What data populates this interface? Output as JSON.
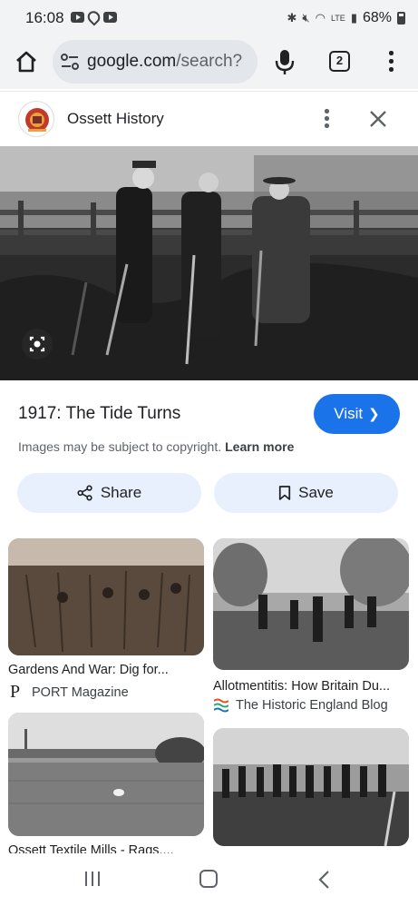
{
  "status_bar": {
    "time": "16:08",
    "battery": "68%",
    "network": "LTE"
  },
  "browser": {
    "url_host": "google.com",
    "url_path": "/search?",
    "tab_count": "2"
  },
  "panel": {
    "site_name": "Ossett History",
    "image_title": "1917: The Tide Turns",
    "visit_label": "Visit",
    "copyright_text": "Images may be subject to copyright.",
    "learn_more_label": "Learn more",
    "share_label": "Share",
    "save_label": "Save"
  },
  "related": [
    {
      "caption": "Gardens And War: Dig for...",
      "source": "PORT Magazine"
    },
    {
      "caption": "Allotmentitis: How Britain Du...",
      "source": "The Historic England Blog"
    },
    {
      "caption": "Ossett Textile Mills - Rags...."
    },
    {
      "caption": ""
    }
  ],
  "colors": {
    "accent": "#1a73e8",
    "chip_bg": "#e8f0fe",
    "toolbar_bg": "#f1f3f4"
  }
}
